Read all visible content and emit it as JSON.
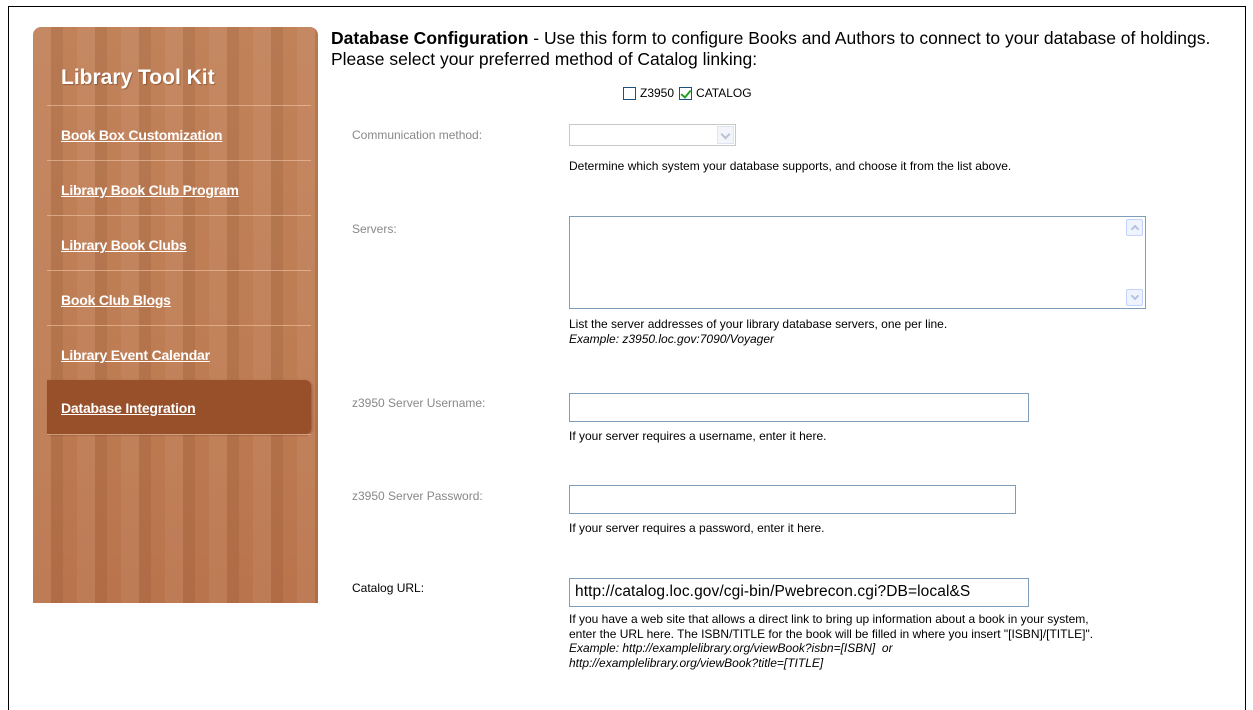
{
  "sidebar": {
    "title": "Library Tool Kit",
    "items": [
      {
        "label": "Book Box Customization"
      },
      {
        "label": "Library Book Club Program"
      },
      {
        "label": "Library Book Clubs"
      },
      {
        "label": "Book Club Blogs"
      },
      {
        "label": "Library Event Calendar"
      },
      {
        "label": "Database Integration",
        "active": true
      }
    ]
  },
  "header": {
    "title": "Database Configuration",
    "intro": " - Use this form to configure Books and Authors to connect to your database of holdings. Please select your preferred method of Catalog linking:"
  },
  "modes": {
    "z3950": {
      "label": "Z3950",
      "checked": false
    },
    "catalog": {
      "label": "CATALOG",
      "checked": true
    }
  },
  "fields": {
    "communication": {
      "label": "Communication method:",
      "value": "",
      "help": "Determine which system your database supports, and choose it from the list above."
    },
    "servers": {
      "label": "Servers:",
      "value": "",
      "help": "List the server addresses of your library database servers, one per line.",
      "example": "Example: z3950.loc.gov:7090/Voyager"
    },
    "username": {
      "label": "z3950 Server Username:",
      "value": "",
      "help": "If your server requires a username, enter it here."
    },
    "password": {
      "label": "z3950 Server Password:",
      "value": "",
      "help": "If your server requires a password, enter it here."
    },
    "catalog_url": {
      "label": "Catalog URL:",
      "value": "http://catalog.loc.gov/cgi-bin/Pwebrecon.cgi?DB=local&S",
      "help1": "If you have a web site that allows a direct link to bring up information about a book in your system,",
      "help2": "enter the URL here. The ISBN/TITLE for the book will be filled in where you insert \"[ISBN]/[TITLE]\".",
      "example1": "Example: http://examplelibrary.org/viewBook?isbn=[ISBN]  or",
      "example2": "http://examplelibrary.org/viewBook?title=[TITLE]"
    }
  }
}
